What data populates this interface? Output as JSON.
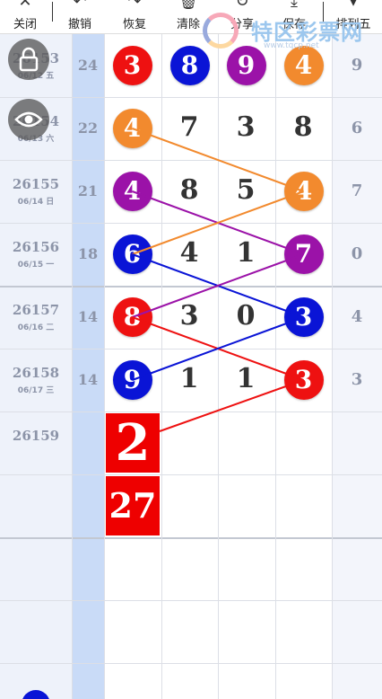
{
  "toolbar": {
    "items": [
      {
        "label": "关闭",
        "icon": "close-icon",
        "glyph": "✕"
      },
      {
        "label": "撤销",
        "icon": "undo-icon",
        "glyph": "↶"
      },
      {
        "label": "恢复",
        "icon": "redo-icon",
        "glyph": "↷"
      },
      {
        "label": "清除",
        "icon": "trash-icon",
        "glyph": "🗑"
      },
      {
        "label": "分享",
        "icon": "share-icon",
        "glyph": "↻"
      },
      {
        "label": "保存",
        "icon": "download-icon",
        "glyph": "⤓"
      },
      {
        "label": "排列五",
        "icon": "chevron-down-icon",
        "glyph": "▾"
      }
    ]
  },
  "watermark": {
    "text": "特区彩票网",
    "url": "www.tqcp.net"
  },
  "rows": [
    {
      "issue": "26153",
      "date": "06/12 五",
      "sum": "24",
      "digits": [
        "3",
        "8",
        "9",
        "4"
      ],
      "fifth": "9",
      "balls": [
        0,
        1,
        2,
        3
      ]
    },
    {
      "issue": "26154",
      "date": "06/13 六",
      "sum": "22",
      "digits": [
        "4",
        "7",
        "3",
        "8"
      ],
      "fifth": "6",
      "balls": [
        0
      ]
    },
    {
      "issue": "26155",
      "date": "06/14 日",
      "sum": "21",
      "digits": [
        "4",
        "8",
        "5",
        "4"
      ],
      "fifth": "7",
      "balls": [
        0,
        3
      ]
    },
    {
      "issue": "26156",
      "date": "06/15 一",
      "sum": "18",
      "digits": [
        "6",
        "4",
        "1",
        "7"
      ],
      "fifth": "0",
      "balls": [
        0,
        3
      ]
    },
    {
      "issue": "26157",
      "date": "06/16 二",
      "sum": "14",
      "digits": [
        "8",
        "3",
        "0",
        "3"
      ],
      "fifth": "4",
      "balls": [
        0,
        3
      ]
    },
    {
      "issue": "26158",
      "date": "06/17 三",
      "sum": "14",
      "digits": [
        "9",
        "1",
        "1",
        "3"
      ],
      "fifth": "3",
      "balls": [
        0,
        3
      ]
    },
    {
      "issue": "26159",
      "date": "",
      "sum": "",
      "digits": [
        "",
        "",
        "",
        ""
      ],
      "fifth": "",
      "balls": []
    }
  ],
  "prediction": {
    "big_digit": "2",
    "sum": "27"
  },
  "colors": {
    "red": "#ee1111",
    "blue": "#0a14d6",
    "purple": "#9b12a8",
    "orange": "#f28a2e"
  }
}
